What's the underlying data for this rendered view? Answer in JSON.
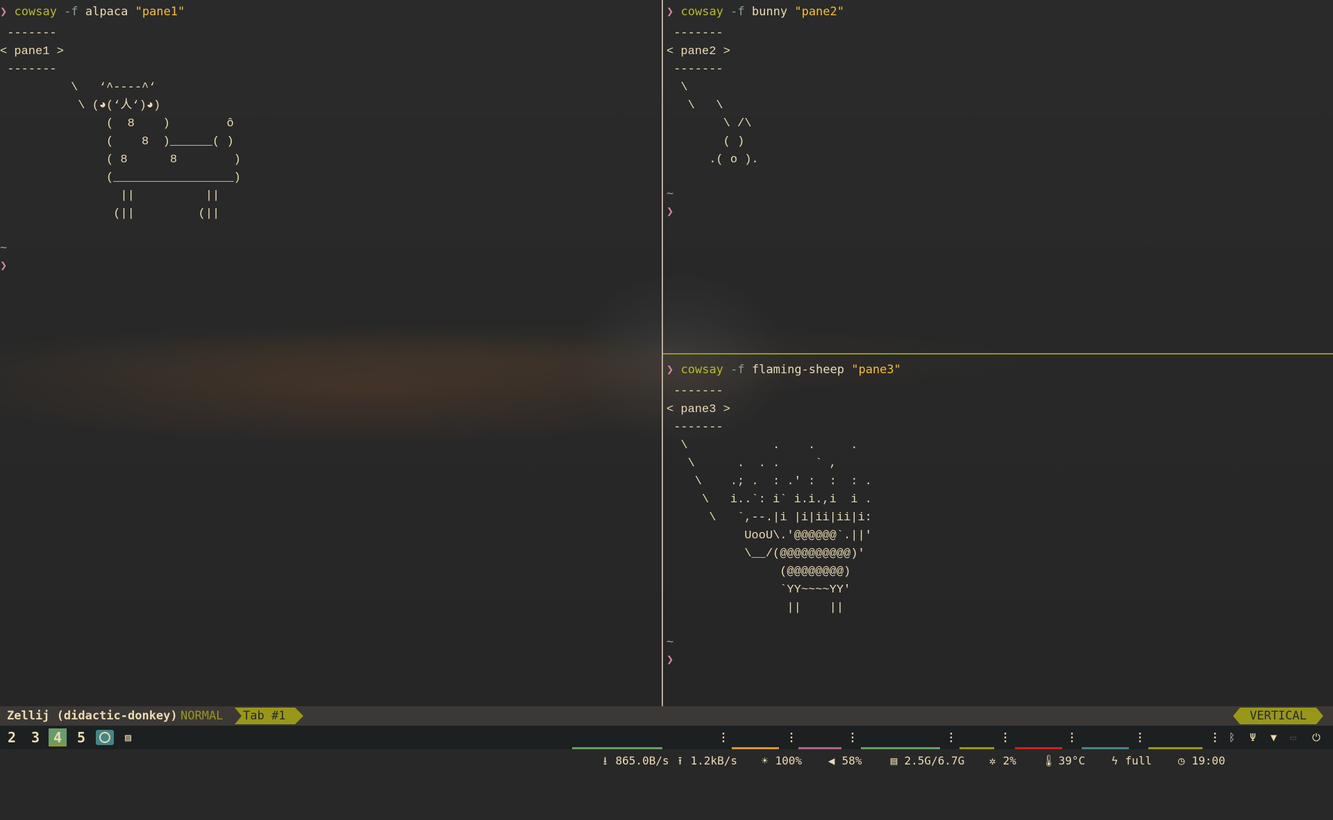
{
  "panes": [
    {
      "command": {
        "prompt": "❯",
        "cmd": "cowsay",
        "flag": "-f",
        "arg": "alpaca",
        "str": "\"pane1\""
      },
      "art": " -------\n< pane1 >\n -------\n          \\   ‘^----^‘\n           \\ (◕(‘人‘)◕)\n               (  8    )        ô\n               (    8  )______( )\n               ( 8      8        )\n               (_________________)\n                 ||          ||\n                (||         (||",
      "tilde": "~",
      "caret": "❯"
    },
    {
      "command": {
        "prompt": "❯",
        "cmd": "cowsay",
        "flag": "-f",
        "arg": "bunny",
        "str": "\"pane2\""
      },
      "art": " -------\n< pane2 >\n -------\n  \\\n   \\   \\\n        \\ /\\\n        ( )\n      .( o ).",
      "tilde": "~",
      "caret": "❯"
    },
    {
      "command": {
        "prompt": "❯",
        "cmd": "cowsay",
        "flag": "-f",
        "arg": "flaming-sheep",
        "str": "\"pane3\""
      },
      "art": " -------\n< pane3 >\n -------\n  \\            .    .     .\n   \\      .  . .     ` ,\n    \\    .; .  : .' :  :  : .\n     \\   i..`: i` i.i.,i  i .\n      \\   `,--.|i |i|ii|ii|i:\n           UooU\\.'@@@@@@`.||'\n           \\__/(@@@@@@@@@@)'\n                (@@@@@@@@)\n                `YY~~~~YY'\n                 ||    ||",
      "tilde": "~",
      "caret": "❯"
    }
  ],
  "statusbar": {
    "session": "Zellij (didactic-donkey)",
    "mode": "NORMAL",
    "tab": "Tab #1",
    "layout": "VERTICAL"
  },
  "waybar": {
    "workspaces": [
      "2",
      "3",
      "4",
      "5"
    ],
    "active_workspace": "4",
    "download": "865.0B/s",
    "upload": "1.2kB/s",
    "brightness": "100%",
    "volume": "58%",
    "memory": "2.5G/6.7G",
    "cpu": "2%",
    "temperature": "39°C",
    "battery": "full",
    "clock": "19:00",
    "separator": "⋮",
    "colors": {
      "download": "#689d6a",
      "brightness": "#d79921",
      "volume": "#b16286",
      "memory": "#689d6a",
      "cpu": "#98971a",
      "temperature": "#cc241d",
      "battery": "#458588",
      "clock": "#98971a"
    },
    "icons": [
      "download-icon",
      "upload-icon",
      "sun-icon",
      "speaker-icon",
      "memory-icon",
      "cpu-icon",
      "thermometer-icon",
      "plug-icon",
      "clock-icon",
      "bluetooth-icon",
      "usb-icon",
      "wifi-icon",
      "keyboard-icon",
      "power-icon"
    ]
  }
}
